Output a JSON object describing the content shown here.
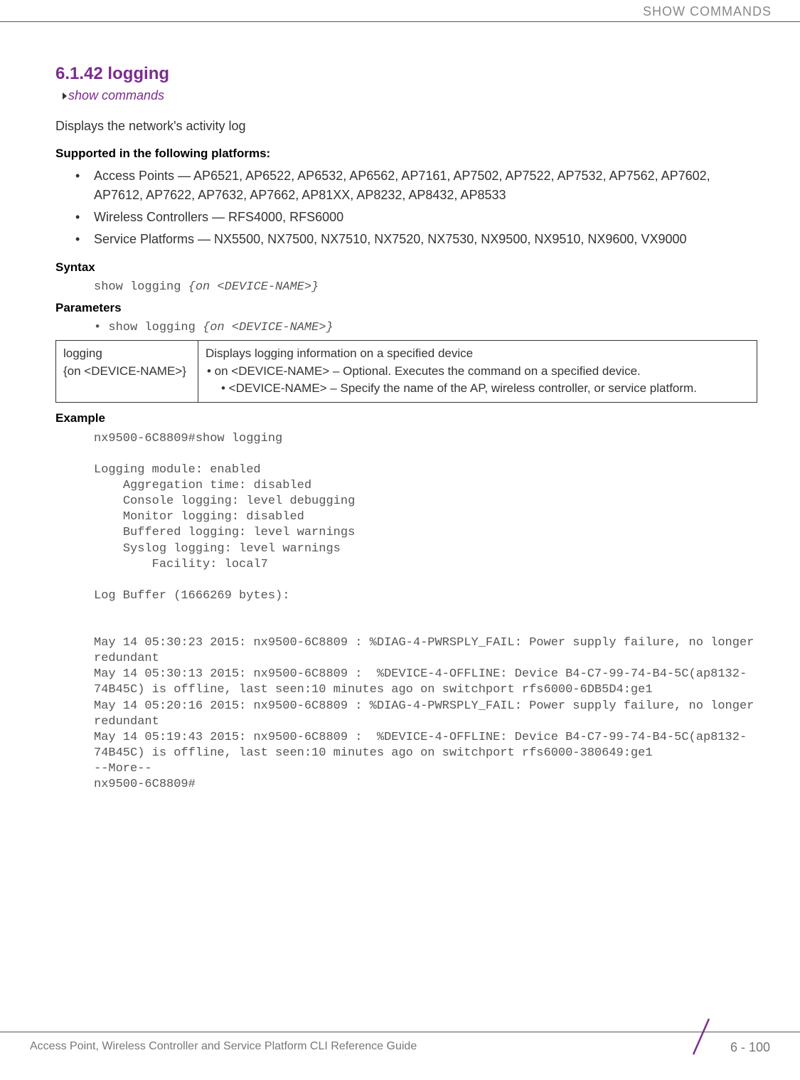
{
  "header": {
    "right_text": "SHOW COMMANDS"
  },
  "section": {
    "number_title": "6.1.42 logging",
    "breadcrumb": "show commands",
    "description": "Displays the network's activity log",
    "supported_heading": "Supported in the following platforms:",
    "platforms": [
      "Access Points — AP6521, AP6522, AP6532, AP6562, AP7161, AP7502, AP7522, AP7532, AP7562, AP7602, AP7612, AP7622, AP7632, AP7662, AP81XX, AP8232, AP8432, AP8533",
      "Wireless Controllers — RFS4000, RFS6000",
      "Service Platforms — NX5500, NX7500, NX7510, NX7520, NX7530, NX9500, NX9510, NX9600, VX9000"
    ],
    "syntax_heading": "Syntax",
    "syntax_cmd_static": "show logging ",
    "syntax_cmd_italic": "{on <DEVICE-NAME>}",
    "parameters_heading": "Parameters",
    "param_bullet_static": "• show logging ",
    "param_bullet_italic": "{on <DEVICE-NAME>}",
    "table": {
      "left_line1": "logging",
      "left_line2": "{on <DEVICE-NAME>}",
      "right_line1": "Displays logging information on a specified device",
      "right_bullet1": "• on <DEVICE-NAME> – Optional. Executes the command on a specified device.",
      "right_bullet2": "• <DEVICE-NAME> – Specify the name of the AP, wireless controller, or service platform."
    },
    "example_heading": "Example",
    "example_text": "nx9500-6C8809#show logging\n\nLogging module: enabled\n    Aggregation time: disabled\n    Console logging: level debugging\n    Monitor logging: disabled\n    Buffered logging: level warnings\n    Syslog logging: level warnings\n        Facility: local7\n\nLog Buffer (1666269 bytes):\n\n\nMay 14 05:30:23 2015: nx9500-6C8809 : %DIAG-4-PWRSPLY_FAIL: Power supply failure, no longer redundant\nMay 14 05:30:13 2015: nx9500-6C8809 :  %DEVICE-4-OFFLINE: Device B4-C7-99-74-B4-5C(ap8132-74B45C) is offline, last seen:10 minutes ago on switchport rfs6000-6DB5D4:ge1\nMay 14 05:20:16 2015: nx9500-6C8809 : %DIAG-4-PWRSPLY_FAIL: Power supply failure, no longer redundant\nMay 14 05:19:43 2015: nx9500-6C8809 :  %DEVICE-4-OFFLINE: Device B4-C7-99-74-B4-5C(ap8132-74B45C) is offline, last seen:10 minutes ago on switchport rfs6000-380649:ge1\n--More--\nnx9500-6C8809#"
  },
  "footer": {
    "left": "Access Point, Wireless Controller and Service Platform CLI Reference Guide",
    "right": "6 - 100"
  }
}
